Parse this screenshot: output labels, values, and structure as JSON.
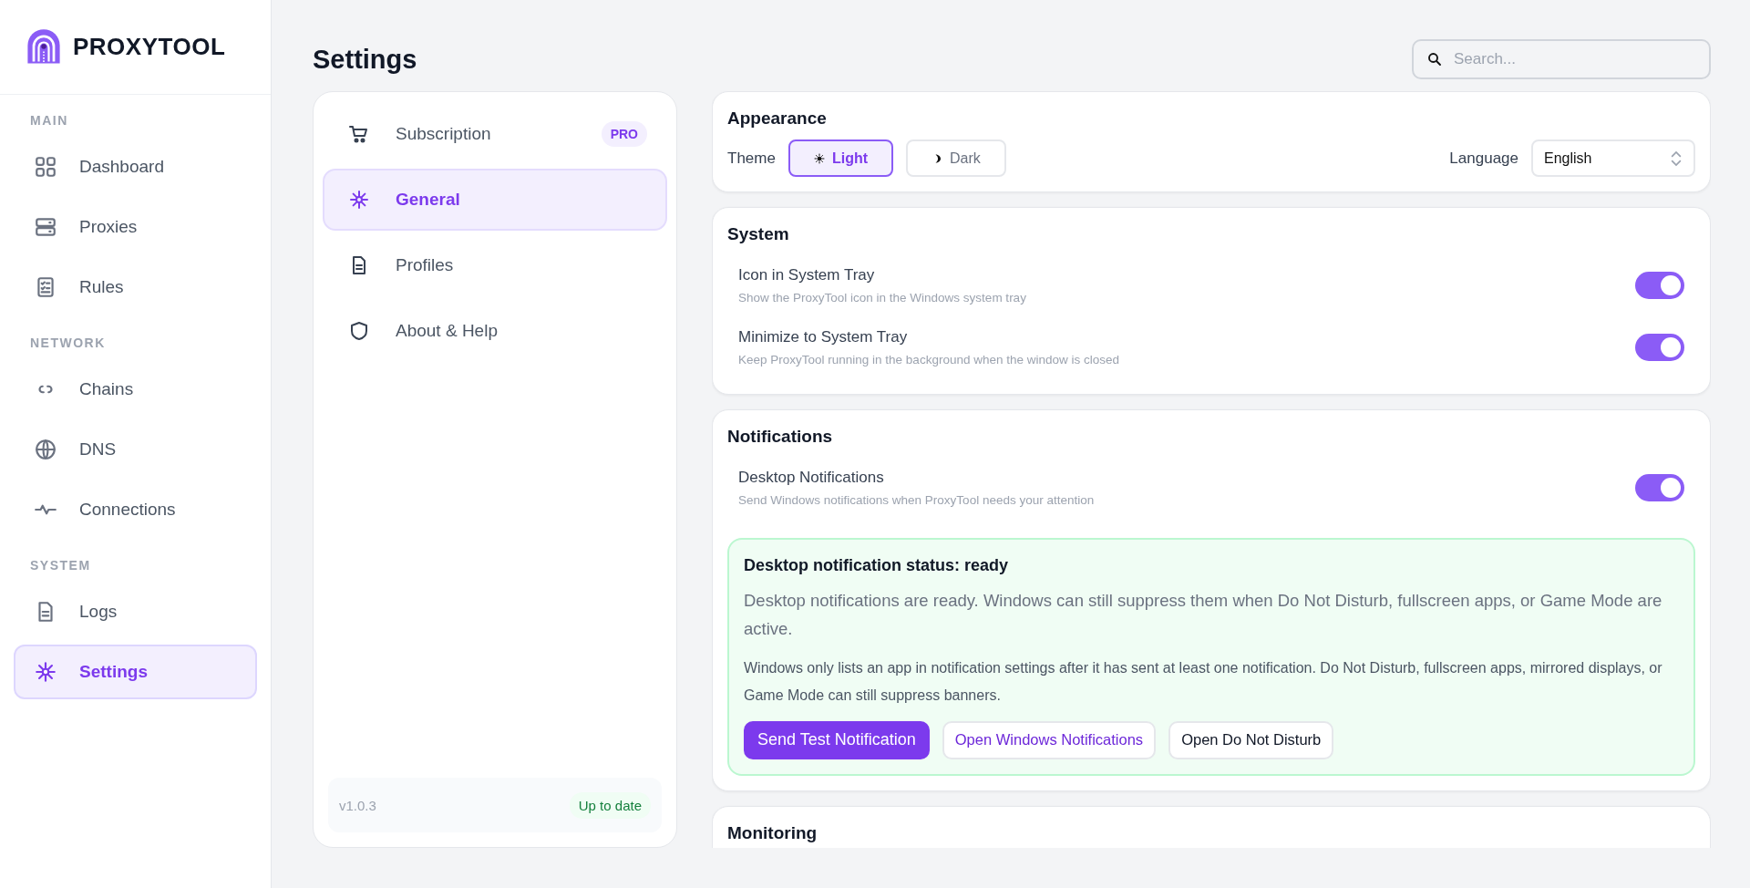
{
  "app": {
    "name": "PROXYTOOL"
  },
  "sidebar": {
    "sections": [
      {
        "title": "MAIN",
        "items": [
          {
            "label": "Dashboard",
            "selected": false
          },
          {
            "label": "Proxies",
            "selected": false
          },
          {
            "label": "Rules",
            "selected": false
          }
        ]
      },
      {
        "title": "NETWORK",
        "items": [
          {
            "label": "Chains",
            "selected": false
          },
          {
            "label": "DNS",
            "selected": false
          },
          {
            "label": "Connections",
            "selected": false
          }
        ]
      },
      {
        "title": "SYSTEM",
        "items": [
          {
            "label": "Logs",
            "selected": false
          },
          {
            "label": "Settings",
            "selected": true
          }
        ]
      }
    ]
  },
  "page_title": "Settings",
  "search": {
    "placeholder": "Search..."
  },
  "settings_nav": {
    "items": [
      {
        "label": "Subscription",
        "badge": "PRO",
        "selected": false
      },
      {
        "label": "General",
        "selected": true
      },
      {
        "label": "Profiles",
        "selected": false
      },
      {
        "label": "About & Help",
        "selected": false
      }
    ],
    "version": "v1.0.3",
    "update_status": "Up to date"
  },
  "appearance": {
    "title": "Appearance",
    "theme_label": "Theme",
    "themes": [
      {
        "label": "Light",
        "selected": true
      },
      {
        "label": "Dark",
        "selected": false
      }
    ],
    "language_label": "Language",
    "language": "English"
  },
  "system": {
    "title": "System",
    "toggles": [
      {
        "label": "Icon in System Tray",
        "description": "Show the ProxyTool icon in the Windows system tray",
        "on": true
      },
      {
        "label": "Minimize to System Tray",
        "description": "Keep ProxyTool running in the background when the window is closed",
        "on": true
      }
    ]
  },
  "notifications": {
    "title": "Notifications",
    "toggles": [
      {
        "label": "Desktop Notifications",
        "description": "Send Windows notifications when ProxyTool needs your attention",
        "on": true
      }
    ],
    "status_panel": {
      "title": "Desktop notification status: ready",
      "paragraphs": [
        "Desktop notifications are ready. Windows can still suppress them when Do Not Disturb, fullscreen apps, or Game Mode are active.",
        "Windows only lists an app in notification settings after it has sent at least one notification. Do Not Disturb, fullscreen apps, mirrored displays, or Game Mode can still suppress banners."
      ],
      "buttons": [
        {
          "label": "Send Test Notification",
          "kind": "primary"
        },
        {
          "label": "Open Windows Notifications",
          "kind": "accent"
        },
        {
          "label": "Open Do Not Disturb",
          "kind": "plain"
        }
      ]
    }
  },
  "monitoring": {
    "title": "Monitoring"
  }
}
